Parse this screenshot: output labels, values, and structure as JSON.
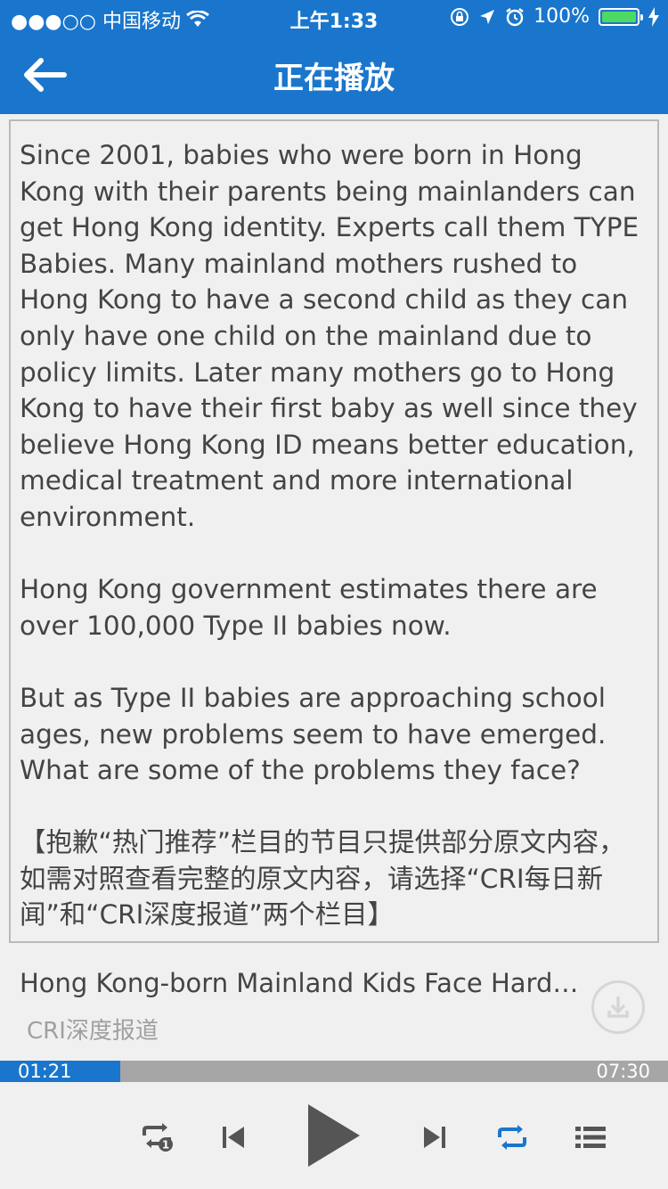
{
  "status_bar": {
    "carrier": "●●●○○ 中国移动",
    "time": "上午1:33",
    "battery": "100%",
    "battery_level": 1.0,
    "icons": [
      "wifi-icon",
      "orientation-lock-icon",
      "location-icon",
      "alarm-icon",
      "battery-icon",
      "charging-icon"
    ]
  },
  "nav": {
    "title": "正在播放",
    "back_icon": "arrow-left-icon"
  },
  "transcript": {
    "paragraphs": [
      "Since 2001, babies who were born in Hong Kong with their parents being mainlanders can get Hong Kong identity. Experts call them TYPE Babies. Many mainland mothers rushed to Hong Kong to have a second child as they can only have one child on the mainland due to policy limits. Later many mothers go to Hong Kong to have their first baby as well since they believe Hong Kong ID means better education, medical treatment and more international environment.",
      "Hong Kong government estimates there are over 100,000 Type II babies now.",
      "But as Type II babies are approaching school ages, new problems seem to have emerged. What are some of the problems they face?",
      "【抱歉“热门推荐”栏目的节目只提供部分原文内容，如需对照查看完整的原文内容，请选择“CRI每日新闻”和“CRI深度报道”两个栏目】"
    ]
  },
  "track": {
    "title": "Hong Kong-born Mainland Kids Face Hardships",
    "source": "CRI深度报道"
  },
  "player": {
    "current_time": "01:21",
    "duration": "07:30",
    "progress": 0.18,
    "colors": {
      "accent": "#1a76cc",
      "icon": "#555555",
      "track": "#a6a6a6"
    },
    "controls": [
      "repeat-one-icon",
      "previous-icon",
      "play-icon",
      "next-icon",
      "repeat-all-icon",
      "playlist-icon"
    ]
  }
}
